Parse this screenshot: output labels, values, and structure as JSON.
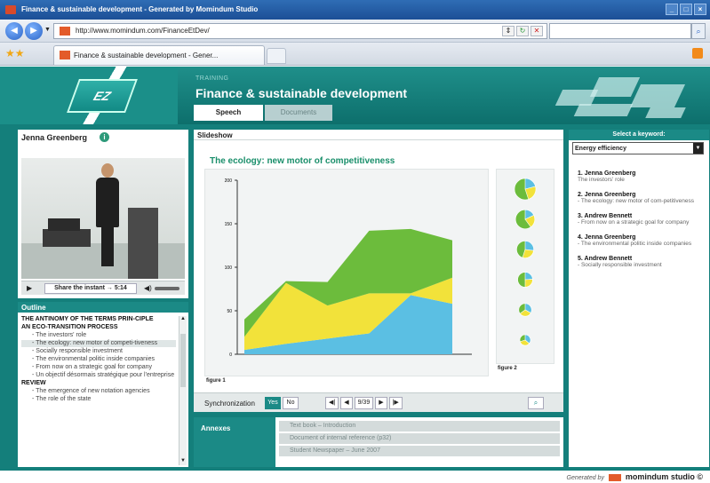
{
  "window": {
    "title": "Finance & sustainable development - Generated by Momindum Studio"
  },
  "browser": {
    "url": "http://www.momindum.com/FinanceEtDev/",
    "tab_title": "Finance & sustainable development - Gener..."
  },
  "app": {
    "training_label": "TRAINING",
    "course_title": "Finance & sustainable development",
    "logo_text": "EZ",
    "tabs": [
      {
        "label": "Speech",
        "active": true
      },
      {
        "label": "Documents",
        "active": false
      }
    ]
  },
  "presenter": {
    "name": "Jenna Greenberg",
    "share_label": "Share the instant → 5:14"
  },
  "outline": {
    "title": "Outline",
    "items": [
      {
        "text": "THE ANTINOMY OF THE TERMS PRIN-CIPLE",
        "level": "sec"
      },
      {
        "text": "AN ECO-TRANSITION PROCESS",
        "level": "sec"
      },
      {
        "text": "- The investors' role",
        "level": "sub"
      },
      {
        "text": "- The ecology: new motor of competi-tiveness",
        "level": "sub"
      },
      {
        "text": "- Socially responsible investment",
        "level": "sub"
      },
      {
        "text": "- The environmental politic inside companies",
        "level": "sub"
      },
      {
        "text": "- From now on a strategic goal for company",
        "level": "sub"
      },
      {
        "text": "- Un objectif désormais stratégique pour l'entreprise",
        "level": "sub"
      },
      {
        "text": "REVIEW",
        "level": "sec"
      },
      {
        "text": "- The emergence of new notation agencies",
        "level": "sub"
      },
      {
        "text": "- The role of the state",
        "level": "sub"
      }
    ]
  },
  "slideshow": {
    "header": "Slideshow",
    "slide_title": "The ecology: new motor of competitiveness",
    "fig1_label": "figure 1",
    "fig2_label": "figure 2",
    "sync_label": "Synchronization",
    "yes": "Yes",
    "no": "No",
    "page": "9/39"
  },
  "chart_data": {
    "type": "area",
    "title": "",
    "ylabel": "",
    "xlabel": "",
    "ylim": [
      0,
      200
    ],
    "yticks": [
      "0",
      "50",
      "100",
      "150",
      "200"
    ],
    "x": [
      1,
      2,
      3,
      4,
      5,
      6
    ],
    "series": [
      {
        "color": "#5bbfe3",
        "values": [
          5,
          12,
          18,
          24,
          68,
          58
        ]
      },
      {
        "color": "#f2e23a",
        "values": [
          15,
          70,
          38,
          46,
          2,
          30
        ]
      },
      {
        "color": "#6cbc3c",
        "values": [
          20,
          2,
          27,
          72,
          74,
          43
        ]
      }
    ],
    "pies": [
      0.35,
      0.3,
      0.45,
      0.4,
      0.55,
      0.6
    ]
  },
  "annexes": {
    "label": "Annexes",
    "items": [
      "Text book – Introduction",
      "Document of internal reference (p32)",
      "Student Newspaper – June 2007"
    ]
  },
  "keyword": {
    "header": "Select a keyword:",
    "selected": "Energy efficiency",
    "results": [
      {
        "name": "1. Jenna Greenberg",
        "desc": "The investors' role"
      },
      {
        "name": "2. Jenna Greenberg",
        "desc": "- The ecology: new motor of com-petitiveness"
      },
      {
        "name": "3. Andrew Bennett",
        "desc": "- From now on a strategic goal for company"
      },
      {
        "name": "4. Jenna Greenberg",
        "desc": "- The environmental politic inside companies"
      },
      {
        "name": "5. Andrew Bennett",
        "desc": "- Socially responsible investment"
      }
    ]
  },
  "footer": {
    "generated_by": "Generated by",
    "brand": "momindum studio ©"
  }
}
